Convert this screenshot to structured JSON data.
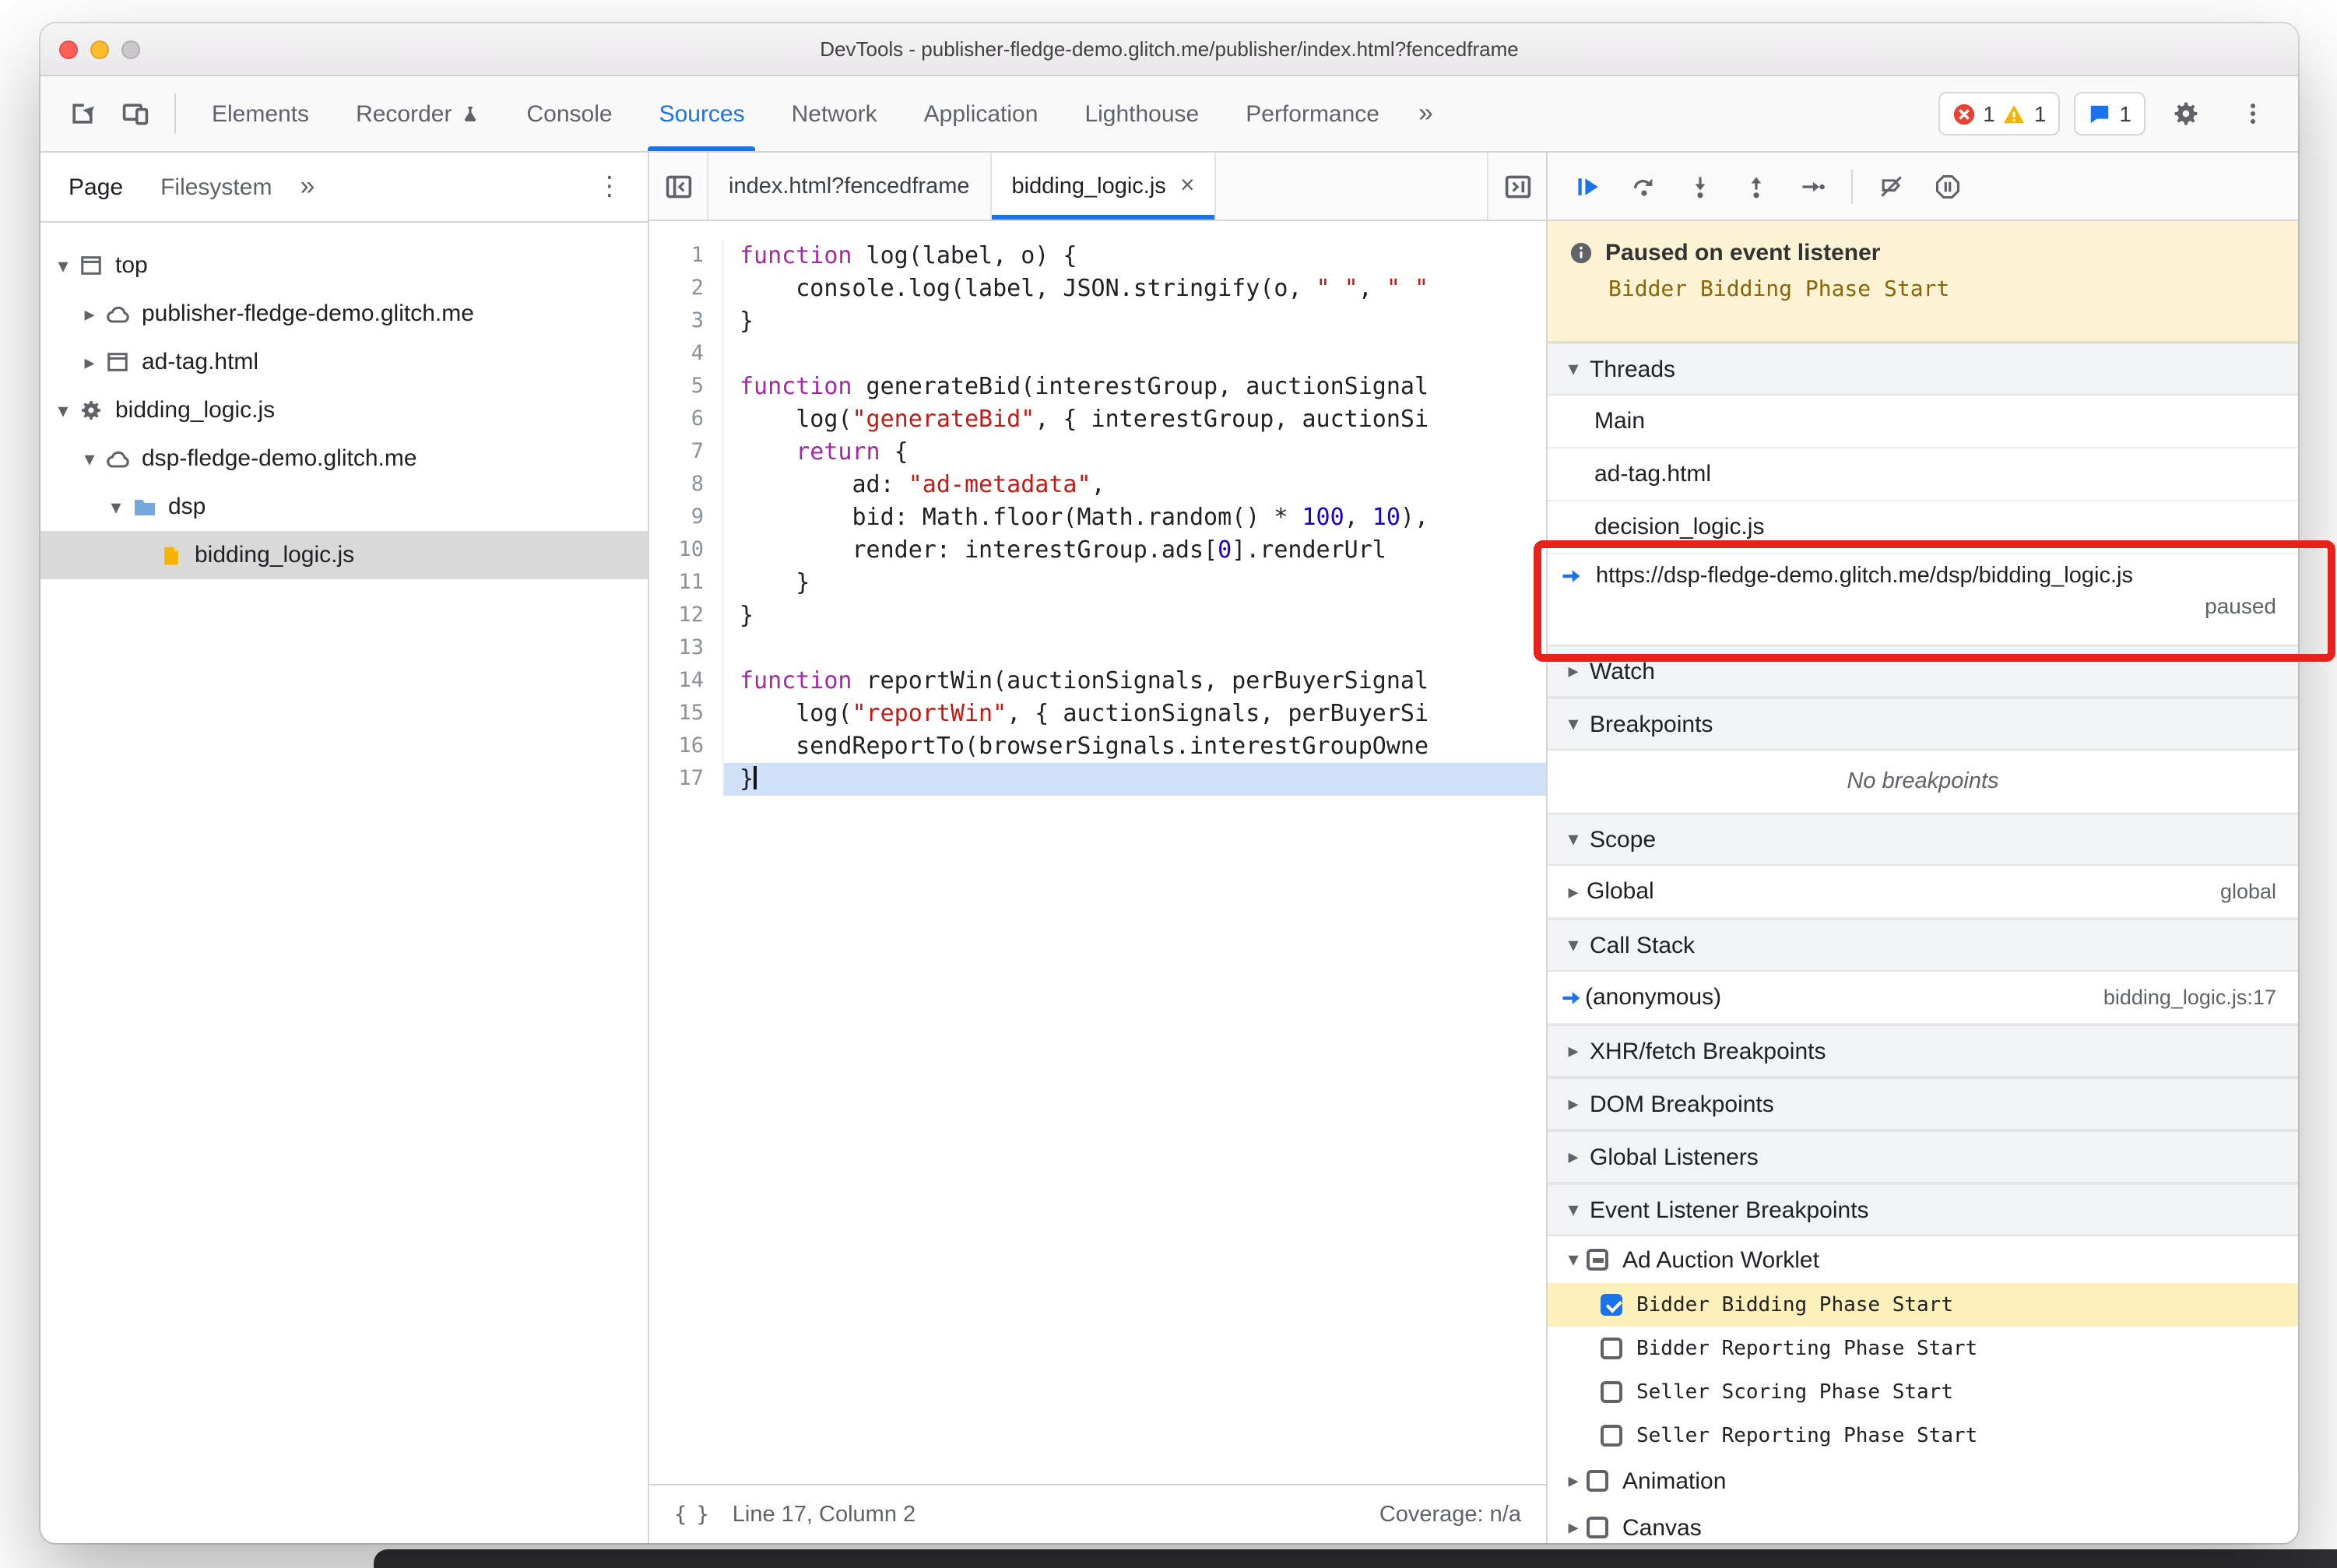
{
  "window": {
    "title": "DevTools - publisher-fledge-demo.glitch.me/publisher/index.html?fencedframe"
  },
  "glyphs": {
    "expanded": "▾",
    "collapsed": "▸",
    "more": "»",
    "kebab": "⋮",
    "pretty": "{ }"
  },
  "toolbar": {
    "tabs": [
      {
        "label": "Elements"
      },
      {
        "label": "Recorder",
        "badge": "flask"
      },
      {
        "label": "Console"
      },
      {
        "label": "Sources",
        "active": true
      },
      {
        "label": "Network"
      },
      {
        "label": "Application"
      },
      {
        "label": "Lighthouse"
      },
      {
        "label": "Performance"
      }
    ],
    "errors": "1",
    "warnings": "1",
    "issues": "1"
  },
  "navigator": {
    "tabs": [
      {
        "label": "Page",
        "active": true
      },
      {
        "label": "Filesystem"
      }
    ],
    "tree": [
      {
        "label": "top",
        "icon": "frame",
        "arrow": "down",
        "indent": 0
      },
      {
        "label": "publisher-fledge-demo.glitch.me",
        "icon": "cloud",
        "arrow": "right",
        "indent": 1
      },
      {
        "label": "ad-tag.html",
        "icon": "frame",
        "arrow": "right",
        "indent": 1
      },
      {
        "label": "bidding_logic.js",
        "icon": "gear",
        "arrow": "down",
        "indent": 0
      },
      {
        "label": "dsp-fledge-demo.glitch.me",
        "icon": "cloud",
        "arrow": "down",
        "indent": 1
      },
      {
        "label": "dsp",
        "icon": "folder",
        "arrow": "down",
        "indent": 2
      },
      {
        "label": "bidding_logic.js",
        "icon": "file",
        "arrow": "none",
        "indent": 3,
        "selected": true
      }
    ]
  },
  "editor": {
    "tabs": [
      {
        "label": "index.html?fencedframe"
      },
      {
        "label": "bidding_logic.js",
        "active": true,
        "close_glyph": "×"
      }
    ],
    "lines": [
      {
        "n": "1",
        "toks": [
          [
            "k",
            "function"
          ],
          [
            "d",
            " log(label, o) {"
          ]
        ]
      },
      {
        "n": "2",
        "toks": [
          [
            "d",
            "    console.log(label, JSON.stringify(o, "
          ],
          [
            "s",
            "\" \""
          ],
          [
            "d",
            ", "
          ],
          [
            "s",
            "\" \""
          ]
        ]
      },
      {
        "n": "3",
        "toks": [
          [
            "d",
            "}"
          ]
        ]
      },
      {
        "n": "4",
        "toks": []
      },
      {
        "n": "5",
        "toks": [
          [
            "k",
            "function"
          ],
          [
            "d",
            " generateBid(interestGroup, auctionSignal"
          ]
        ]
      },
      {
        "n": "6",
        "toks": [
          [
            "d",
            "    log("
          ],
          [
            "s",
            "\"generateBid\""
          ],
          [
            "d",
            ", { interestGroup, auctionSi"
          ]
        ]
      },
      {
        "n": "7",
        "toks": [
          [
            "d",
            "    "
          ],
          [
            "k",
            "return"
          ],
          [
            "d",
            " {"
          ]
        ]
      },
      {
        "n": "8",
        "toks": [
          [
            "d",
            "        ad: "
          ],
          [
            "s",
            "\"ad-metadata\""
          ],
          [
            "d",
            ","
          ]
        ]
      },
      {
        "n": "9",
        "toks": [
          [
            "d",
            "        bid: Math.floor(Math.random() * "
          ],
          [
            "n",
            "100"
          ],
          [
            "d",
            ", "
          ],
          [
            "n",
            "10"
          ],
          [
            "d",
            "),"
          ]
        ]
      },
      {
        "n": "10",
        "toks": [
          [
            "d",
            "        render: interestGroup.ads["
          ],
          [
            "n",
            "0"
          ],
          [
            "d",
            "].renderUrl"
          ]
        ]
      },
      {
        "n": "11",
        "toks": [
          [
            "d",
            "    }"
          ]
        ]
      },
      {
        "n": "12",
        "toks": [
          [
            "d",
            "}"
          ]
        ]
      },
      {
        "n": "13",
        "toks": []
      },
      {
        "n": "14",
        "toks": [
          [
            "k",
            "function"
          ],
          [
            "d",
            " reportWin(auctionSignals, perBuyerSignal"
          ]
        ]
      },
      {
        "n": "15",
        "toks": [
          [
            "d",
            "    log("
          ],
          [
            "s",
            "\"reportWin\""
          ],
          [
            "d",
            ", { auctionSignals, perBuyerSi"
          ]
        ]
      },
      {
        "n": "16",
        "toks": [
          [
            "d",
            "    sendReportTo(browserSignals.interestGroupOwne"
          ]
        ]
      },
      {
        "n": "17",
        "toks": [
          [
            "d",
            "}"
          ]
        ],
        "current": true
      }
    ],
    "status": {
      "pretty_glyph": "{ }",
      "line_col": "Line 17, Column 2",
      "coverage": "Coverage: n/a"
    }
  },
  "debugger": {
    "controls": [
      "resume",
      "step-over",
      "step-into",
      "step-out",
      "step",
      "separator",
      "deactivate-breakpoints",
      "pause-on-exceptions"
    ],
    "banner": {
      "title": "Paused on event listener",
      "detail": "Bidder Bidding Phase Start"
    },
    "threads": {
      "title": "Threads",
      "items": [
        {
          "label": "Main"
        },
        {
          "label": "ad-tag.html"
        },
        {
          "label": "decision_logic.js"
        },
        {
          "label": "https://dsp-fledge-demo.glitch.me/dsp/bidding_logic.js",
          "status": "paused",
          "active": true,
          "annotated": true
        }
      ]
    },
    "watch": {
      "title": "Watch"
    },
    "breakpoints": {
      "title": "Breakpoints",
      "empty": "No breakpoints"
    },
    "scope": {
      "title": "Scope",
      "rows": [
        {
          "label": "Global",
          "value": "global"
        }
      ]
    },
    "call_stack": {
      "title": "Call Stack",
      "rows": [
        {
          "label": "(anonymous)",
          "value": "bidding_logic.js:17",
          "active": true
        }
      ]
    },
    "xhr": {
      "title": "XHR/fetch Breakpoints"
    },
    "dom": {
      "title": "DOM Breakpoints"
    },
    "global_listeners": {
      "title": "Global Listeners"
    },
    "event_listener_breakpoints": {
      "title": "Event Listener Breakpoints",
      "categories": [
        {
          "label": "Ad Auction Worklet",
          "checkbox": "indeterminate",
          "expanded": true,
          "children": [
            {
              "label": "Bidder Bidding Phase Start",
              "checked": true,
              "highlighted": true
            },
            {
              "label": "Bidder Reporting Phase Start",
              "checked": false
            },
            {
              "label": "Seller Scoring Phase Start",
              "checked": false
            },
            {
              "label": "Seller Reporting Phase Start",
              "checked": false
            }
          ]
        },
        {
          "label": "Animation",
          "checkbox": "unchecked",
          "expanded": false,
          "children": []
        },
        {
          "label": "Canvas",
          "checkbox": "unchecked",
          "expanded": false,
          "children": []
        }
      ]
    }
  }
}
